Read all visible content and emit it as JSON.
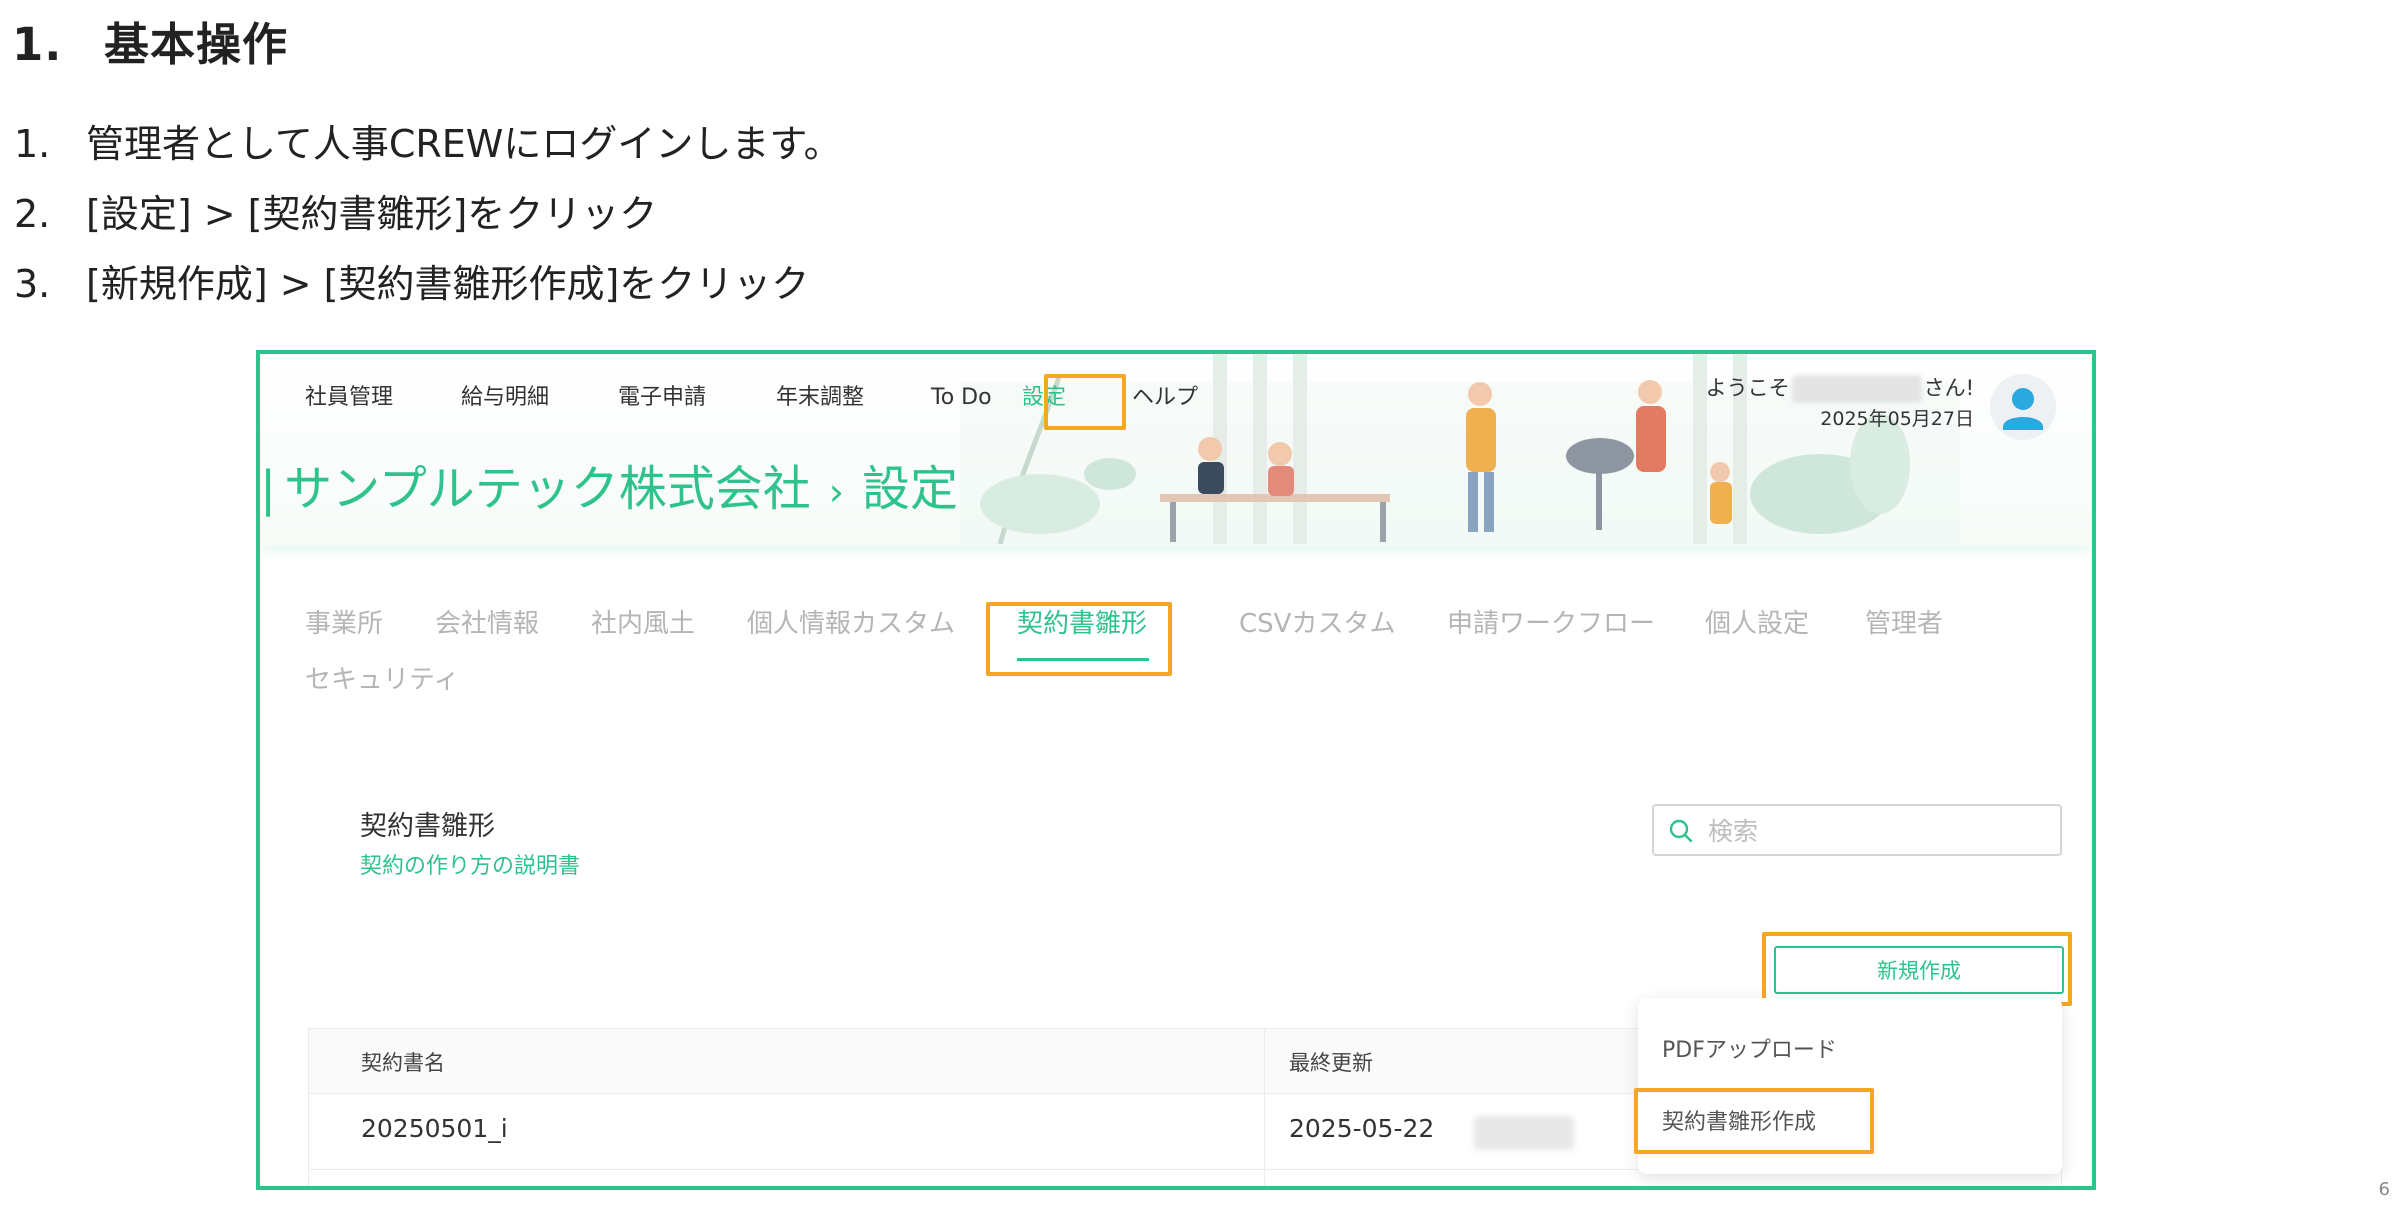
{
  "heading": {
    "number": "1.",
    "title": "基本操作"
  },
  "steps": [
    {
      "number": "1.",
      "text": "管理者として人事CREWにログインします。"
    },
    {
      "number": "2.",
      "text": "[設定] > [契約書雛形]をクリック"
    },
    {
      "number": "3.",
      "text": "[新規作成] > [契約書雛形作成]をクリック"
    }
  ],
  "screenshot": {
    "topnav": [
      "社員管理",
      "給与明細",
      "電子申請",
      "年末調整",
      "To Do",
      "設定",
      "ヘルプ"
    ],
    "welcome": {
      "prefix": "ようこそ",
      "suffix": "さん!",
      "date": "2025年05月27日"
    },
    "breadcrumb": {
      "company": "サンプルテック株式会社",
      "separator": "›",
      "page": "設定"
    },
    "tabs": [
      "事業所",
      "会社情報",
      "社内風土",
      "個人情報カスタム",
      "契約書雛形",
      "CSVカスタム",
      "申請ワークフロー",
      "個人設定",
      "管理者",
      "セキュリティ"
    ],
    "section": {
      "title": "契約書雛形",
      "help_link": "契約の作り方の説明書"
    },
    "search": {
      "placeholder": "検索",
      "value": ""
    },
    "new_button": "新規作成",
    "table": {
      "headers": [
        "契約書名",
        "最終更新"
      ],
      "rows": [
        {
          "name": "20250501_i",
          "updated": "2025-05-22"
        }
      ]
    },
    "dropdown": [
      "PDFアップロード",
      "契約書雛形作成"
    ]
  },
  "page_number": "6",
  "colors": {
    "accent": "#2ec38c",
    "highlight": "#f5a623"
  }
}
